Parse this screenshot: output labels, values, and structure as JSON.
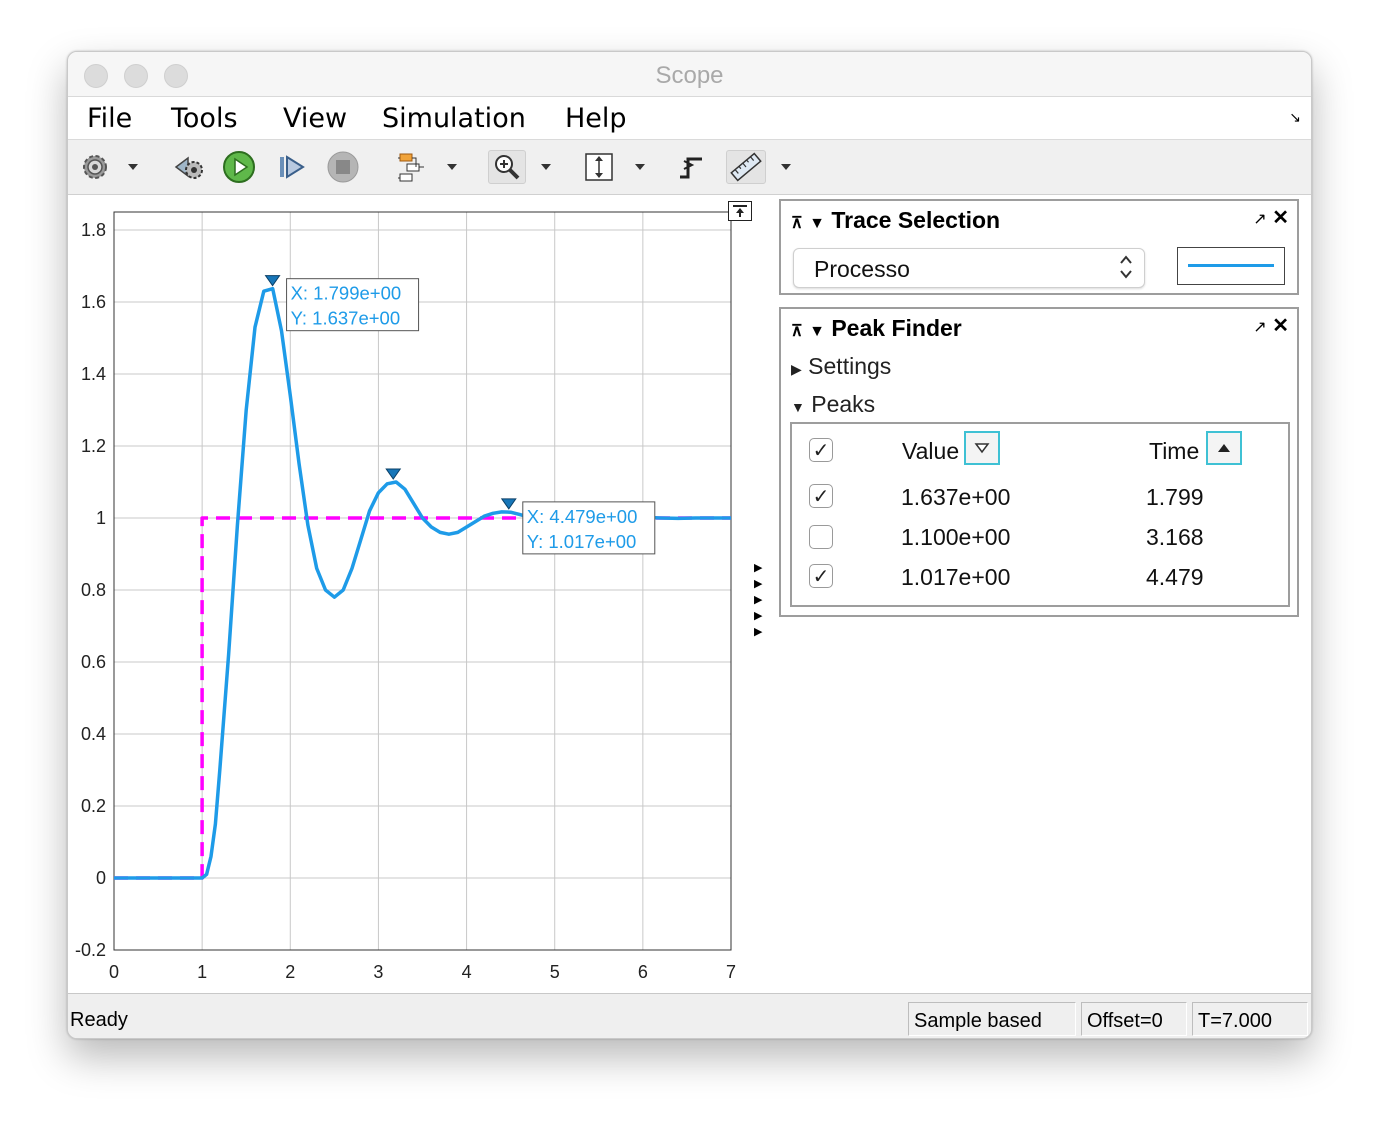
{
  "window": {
    "title": "Scope"
  },
  "menu": [
    "File",
    "Tools",
    "View",
    "Simulation",
    "Help"
  ],
  "toolbar": {
    "icons": [
      "gear-icon",
      "step-back-icon",
      "run-icon",
      "step-forward-icon",
      "stop-icon",
      "signal-hierarchy-icon",
      "zoom-in-icon",
      "scale-axes-icon",
      "triggers-icon",
      "measurements-icon"
    ]
  },
  "trace_selection": {
    "title": "Trace Selection",
    "selected": "Processo",
    "line_color": "#1e9be8"
  },
  "peak_finder": {
    "title": "Peak Finder",
    "settings_label": "Settings",
    "peaks_label": "Peaks",
    "columns": {
      "value": "Value",
      "time": "Time"
    },
    "rows": [
      {
        "checked": true,
        "value": "1.637e+00",
        "time": "1.799"
      },
      {
        "checked": false,
        "value": "1.100e+00",
        "time": "3.168"
      },
      {
        "checked": true,
        "value": "1.017e+00",
        "time": "4.479"
      }
    ]
  },
  "status": {
    "left": "Ready",
    "sample": "Sample based",
    "offset": "Offset=0",
    "time": "T=7.000"
  },
  "chart_data": {
    "type": "line",
    "xlim": [
      0,
      7
    ],
    "ylim": [
      -0.2,
      1.85
    ],
    "xticks": [
      0,
      1,
      2,
      3,
      4,
      5,
      6,
      7
    ],
    "yticks": [
      -0.2,
      0,
      0.2,
      0.4,
      0.6,
      0.8,
      1,
      1.2,
      1.4,
      1.6,
      1.8
    ],
    "ytick_labels": [
      "-0.2",
      "0",
      "0.2",
      "0.4",
      "0.6",
      "0.8",
      "1",
      "1.2",
      "1.4",
      "1.6",
      "1.8"
    ],
    "grid": true,
    "series": [
      {
        "color": "#1e9be8",
        "style": "solid",
        "x": [
          0,
          1.0,
          1.05,
          1.1,
          1.15,
          1.2,
          1.3,
          1.4,
          1.5,
          1.6,
          1.7,
          1.8,
          1.9,
          2.0,
          2.1,
          2.2,
          2.3,
          2.4,
          2.5,
          2.6,
          2.7,
          2.8,
          2.9,
          3.0,
          3.1,
          3.2,
          3.3,
          3.4,
          3.5,
          3.6,
          3.7,
          3.8,
          3.9,
          4.0,
          4.1,
          4.2,
          4.3,
          4.4,
          4.5,
          4.6,
          4.7,
          4.8,
          4.9,
          5.0,
          5.2,
          5.4,
          5.6,
          5.8,
          6.0,
          6.2,
          6.4,
          6.6,
          6.8,
          7.0
        ],
        "y": [
          0,
          0,
          0.01,
          0.06,
          0.15,
          0.3,
          0.62,
          0.98,
          1.3,
          1.53,
          1.63,
          1.637,
          1.52,
          1.34,
          1.15,
          0.98,
          0.86,
          0.8,
          0.78,
          0.8,
          0.86,
          0.94,
          1.02,
          1.07,
          1.095,
          1.1,
          1.08,
          1.04,
          1.0,
          0.975,
          0.96,
          0.955,
          0.96,
          0.975,
          0.99,
          1.005,
          1.013,
          1.017,
          1.016,
          1.01,
          1.003,
          0.997,
          0.993,
          0.992,
          0.994,
          0.998,
          1.002,
          1.003,
          1.002,
          1.0,
          0.999,
          1.0,
          1.0,
          1.0
        ]
      },
      {
        "color": "#ff00ff",
        "style": "dashed",
        "x": [
          0,
          1,
          1,
          7
        ],
        "y": [
          0,
          0,
          1,
          1
        ]
      }
    ],
    "peaks": [
      {
        "x": 1.799,
        "y": 1.637,
        "label_x": "X:  1.799e+00",
        "label_y": "Y:  1.637e+00"
      },
      {
        "x": 3.168,
        "y": 1.1
      },
      {
        "x": 4.479,
        "y": 1.017,
        "label_x": "X:  4.479e+00",
        "label_y": "Y:  1.017e+00"
      }
    ]
  }
}
